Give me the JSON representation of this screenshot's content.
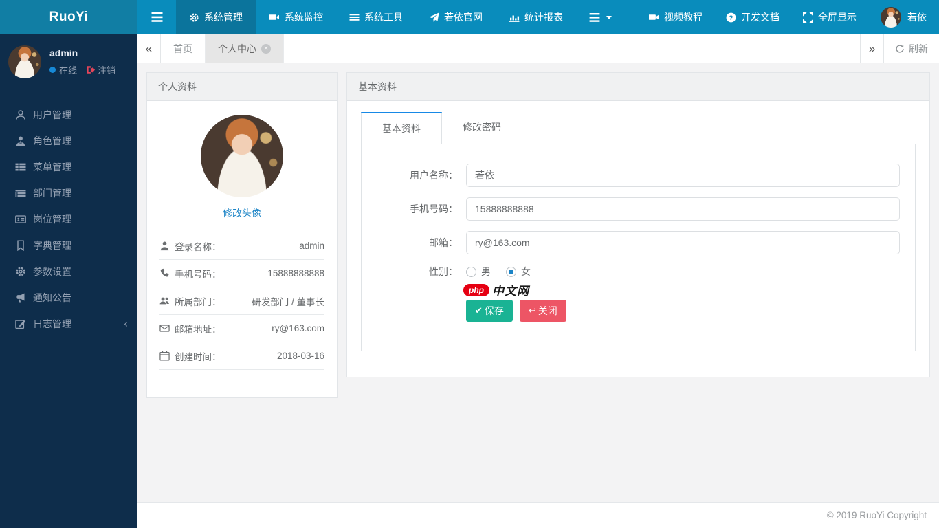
{
  "brand": "RuoYi",
  "colors": {
    "navbar": "#098cbc",
    "navbar_logo": "#117ea4",
    "navbar_active": "#0b749c",
    "sidebar": "#0e2d4b",
    "link_blue": "#1c84c6",
    "tab_accent": "#1789e6",
    "success_green": "#1ab394",
    "danger_red": "#ed5565",
    "online_dot": "#1789d6"
  },
  "topnav": {
    "items": [
      {
        "label": "系统管理",
        "icon": "gear-icon",
        "active": true
      },
      {
        "label": "系统监控",
        "icon": "monitor-video-icon",
        "active": false
      },
      {
        "label": "系统工具",
        "icon": "tools-list-icon",
        "active": false
      },
      {
        "label": "若依官网",
        "icon": "send-icon",
        "active": false
      },
      {
        "label": "统计报表",
        "icon": "bar-chart-icon",
        "active": false
      }
    ],
    "right_items": [
      {
        "label": "视频教程",
        "icon": "video-icon"
      },
      {
        "label": "开发文档",
        "icon": "question-icon"
      },
      {
        "label": "全屏显示",
        "icon": "expand-icon"
      }
    ],
    "user_name": "若依"
  },
  "tabsbar": {
    "tabs": [
      {
        "label": "首页",
        "active": false,
        "closable": false
      },
      {
        "label": "个人中心",
        "active": true,
        "closable": true
      }
    ],
    "refresh_label": "刷新"
  },
  "sidebar": {
    "user": {
      "name": "admin",
      "status": "在线",
      "logout": "注销"
    },
    "items": [
      {
        "label": "用户管理",
        "icon": "user-icon"
      },
      {
        "label": "角色管理",
        "icon": "role-icon"
      },
      {
        "label": "菜单管理",
        "icon": "menu-list-icon"
      },
      {
        "label": "部门管理",
        "icon": "dept-tree-icon"
      },
      {
        "label": "岗位管理",
        "icon": "id-card-icon"
      },
      {
        "label": "字典管理",
        "icon": "bookmark-icon"
      },
      {
        "label": "参数设置",
        "icon": "settings-icon"
      },
      {
        "label": "通知公告",
        "icon": "bullhorn-icon"
      },
      {
        "label": "日志管理",
        "icon": "log-edit-icon",
        "has_children": true,
        "chevron": "‹"
      }
    ]
  },
  "profile_panel": {
    "title": "个人资料",
    "avatar_link": "修改头像",
    "rows": [
      {
        "icon": "user-icon",
        "label": "登录名称：",
        "value": "admin"
      },
      {
        "icon": "phone-icon",
        "label": "手机号码：",
        "value": "15888888888"
      },
      {
        "icon": "users-icon",
        "label": "所属部门：",
        "value": "研发部门 / 董事长"
      },
      {
        "icon": "mail-icon",
        "label": "邮箱地址：",
        "value": "ry@163.com"
      },
      {
        "icon": "calendar-icon",
        "label": "创建时间：",
        "value": "2018-03-16"
      }
    ]
  },
  "form_panel": {
    "title": "基本资料",
    "tabs": [
      {
        "label": "基本资料",
        "active": true
      },
      {
        "label": "修改密码",
        "active": false
      }
    ],
    "fields": [
      {
        "label": "用户名称：",
        "value": "若依"
      },
      {
        "label": "手机号码：",
        "value": "15888888888"
      },
      {
        "label": "邮箱：",
        "value": "ry@163.com"
      }
    ],
    "gender": {
      "label": "性别：",
      "options": [
        {
          "label": "男",
          "checked": false
        },
        {
          "label": "女",
          "checked": true
        }
      ]
    },
    "watermark": {
      "badge": "php",
      "text": "中文网"
    },
    "buttons": [
      {
        "label": "保存",
        "icon": "check-icon",
        "style": "success"
      },
      {
        "label": "关闭",
        "icon": "reply-icon",
        "style": "danger"
      }
    ]
  },
  "footer": {
    "copyright": "© 2019 RuoYi Copyright"
  }
}
